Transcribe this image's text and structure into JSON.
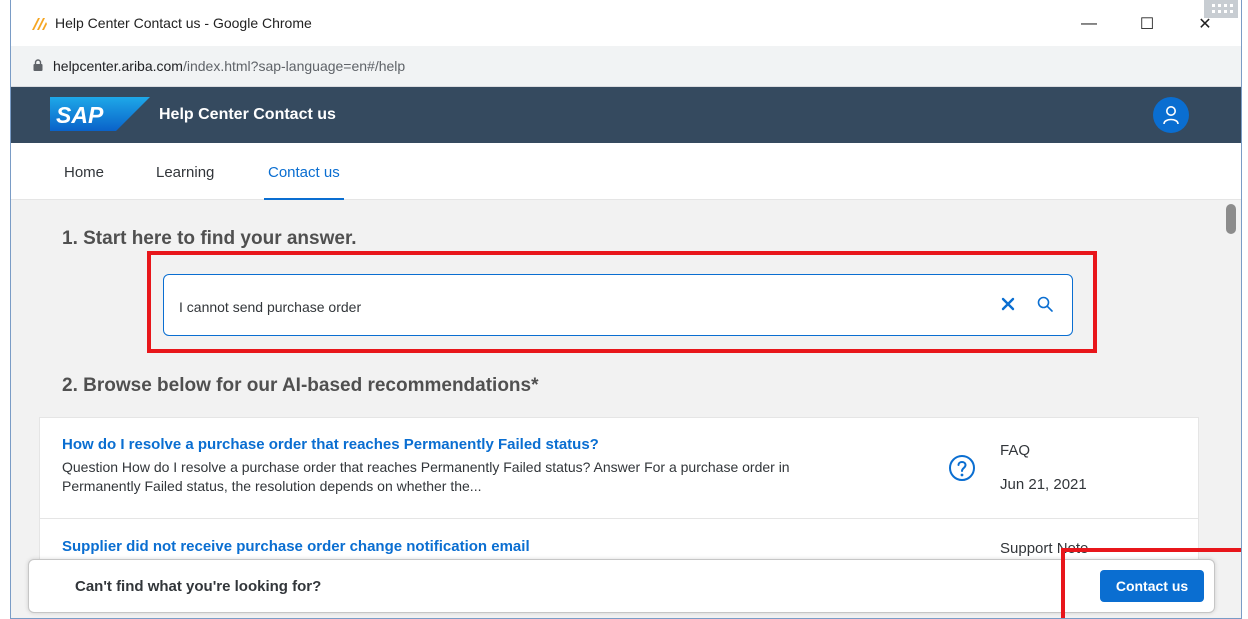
{
  "window": {
    "title": "Help Center Contact us - Google Chrome",
    "minimize_glyph": "—",
    "maximize_glyph": "☐",
    "close_glyph": "✕"
  },
  "address_bar": {
    "url_host": "helpcenter.ariba.com",
    "url_path": "/index.html?sap-language=en#/help"
  },
  "header": {
    "logo_text": "SAP",
    "app_title": "Help Center Contact us"
  },
  "nav": {
    "tabs": [
      {
        "label": "Home",
        "active": false
      },
      {
        "label": "Learning",
        "active": false
      },
      {
        "label": "Contact us",
        "active": true
      }
    ]
  },
  "step1": {
    "title": "1. Start here to find your answer.",
    "search_value": "I cannot send purchase order"
  },
  "step2": {
    "title": "2. Browse below for our AI-based recommendations*"
  },
  "results": [
    {
      "title": "How do I resolve a purchase order that reaches Permanently Failed status?",
      "description": "Question How do I resolve a purchase order that reaches Permanently Failed status? Answer For a purchase order in Permanently Failed status, the resolution depends on whether the...",
      "type": "FAQ",
      "date": "Jun 21, 2021",
      "icon": "question-circle-icon"
    },
    {
      "title": "Supplier did not receive purchase order change notification email",
      "description": "",
      "type": "Support Note",
      "date": "",
      "icon": "support-note-icon"
    }
  ],
  "footer": {
    "prompt": "Can't find what you're looking for?",
    "button_label": "Contact us"
  },
  "colors": {
    "shell_header": "#354a5f",
    "accent": "#0a6ed1",
    "highlight_red": "#e8161b"
  }
}
